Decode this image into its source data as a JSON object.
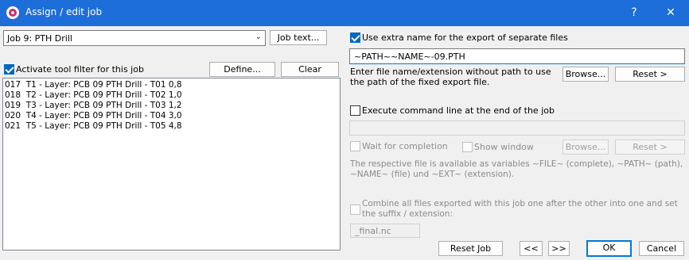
{
  "window": {
    "title": "Assign / edit job",
    "help_label": "?",
    "close_label": "✕"
  },
  "job_select": {
    "value": "Job 9: PTH Drill"
  },
  "buttons": {
    "job_text": "Job text...",
    "define": "Define...",
    "clear": "Clear",
    "browse1": "Browse...",
    "reset1": "Reset >",
    "browse2": "Browse...",
    "reset2": "Reset >",
    "reset_job": "Reset Job",
    "prev": "<<",
    "next": ">>",
    "ok": "OK",
    "cancel": "Cancel"
  },
  "tool_filter": {
    "label": "Activate tool filter for this job",
    "checked": true
  },
  "tool_list": [
    "017  T1 - Layer: PCB 09 PTH Drill - T01 0,8",
    "018  T2 - Layer: PCB 09 PTH Drill - T02 1,0",
    "019  T3 - Layer: PCB 09 PTH Drill - T03 1,2",
    "020  T4 - Layer: PCB 09 PTH Drill - T04 3,0",
    "021  T5 - Layer: PCB 09 PTH Drill - T05 4,8"
  ],
  "extra_name": {
    "label": "Use extra name for the export of separate files",
    "checked": true,
    "value": "~PATH~~NAME~-09.PTH",
    "hint_line1": "Enter file name/extension without path to use",
    "hint_line2": "the path of the fixed export file."
  },
  "command_line": {
    "label": "Execute command line at the end of the job",
    "checked": false,
    "value": ""
  },
  "wait": {
    "label": "Wait for completion",
    "checked": false
  },
  "show_window": {
    "label": "Show window",
    "checked": false
  },
  "variables_note": {
    "line1": "The respective file is available as variables ~FILE~ (complete), ~PATH~ (path),",
    "line2": "~NAME~ (file) und ~EXT~ (extension)."
  },
  "combine": {
    "line1": "Combine all files exported with this job one after the other into one and set",
    "line2": "the suffix / extension:",
    "checked": false,
    "suffix": "_final.nc"
  },
  "colors": {
    "titlebar": "#1d6ed9",
    "accent": "#0078d7",
    "checkbox": "#0067c0"
  }
}
